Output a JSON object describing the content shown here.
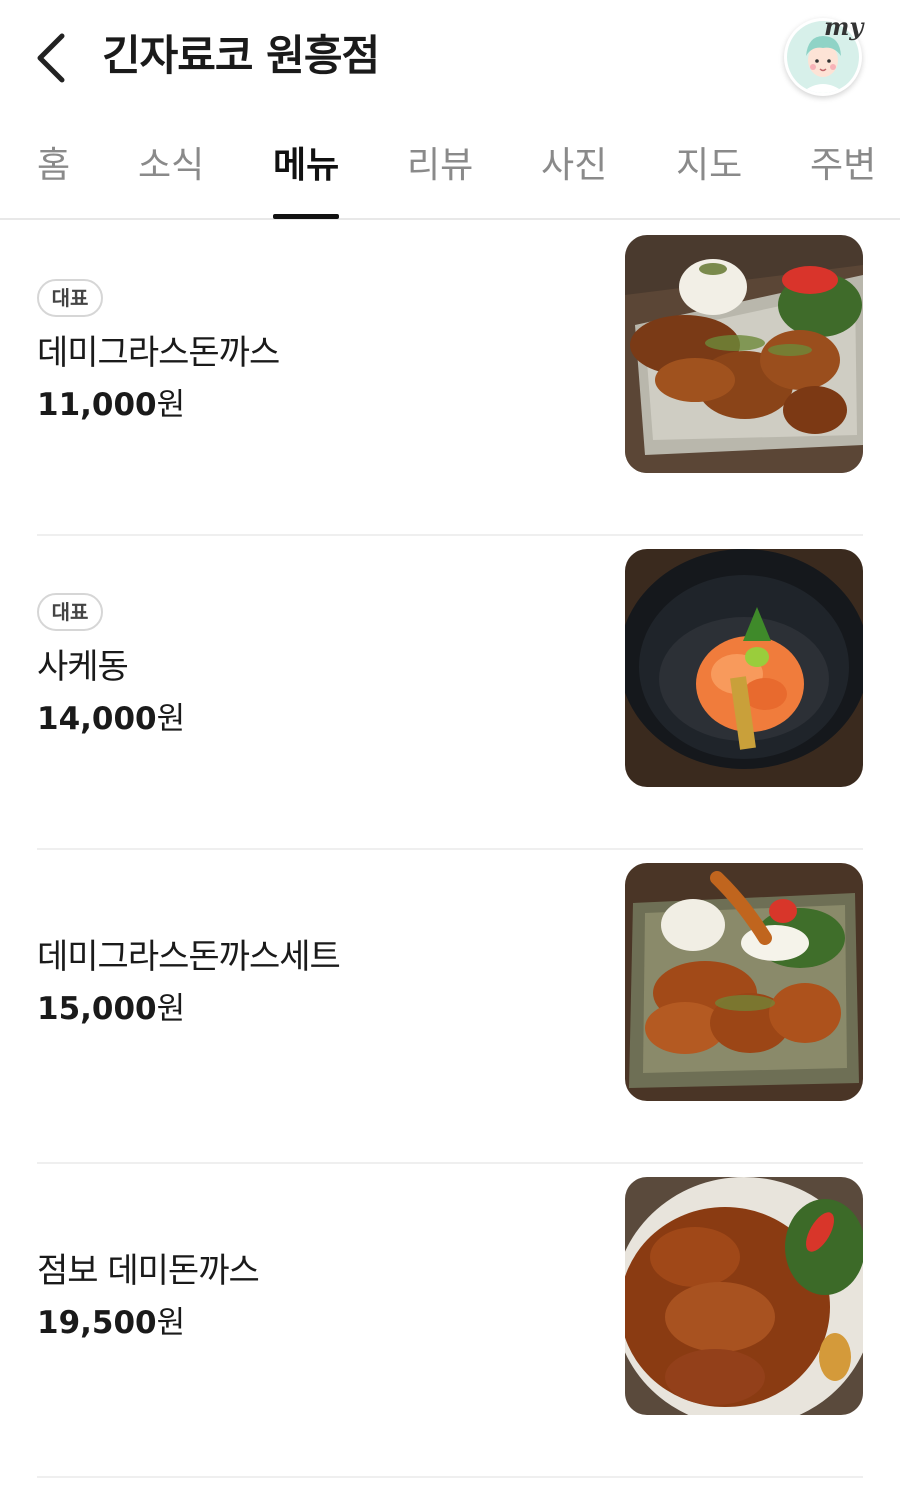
{
  "header": {
    "title": "긴자료코 원흥점",
    "back_icon": "chevron-left-icon",
    "avatar_label": "my"
  },
  "tabs": [
    {
      "label": "홈",
      "active": false
    },
    {
      "label": "소식",
      "active": false
    },
    {
      "label": "메뉴",
      "active": true
    },
    {
      "label": "리뷰",
      "active": false
    },
    {
      "label": "사진",
      "active": false
    },
    {
      "label": "지도",
      "active": false
    },
    {
      "label": "주변",
      "active": false
    }
  ],
  "menu": {
    "items": [
      {
        "badge": "대표",
        "name": "데미그라스돈까스",
        "price": "11,000",
        "unit": "원"
      },
      {
        "badge": "대표",
        "name": "사케동",
        "price": "14,000",
        "unit": "원"
      },
      {
        "badge": "",
        "name": "데미그라스돈까스세트",
        "price": "15,000",
        "unit": "원"
      },
      {
        "badge": "",
        "name": "점보 데미돈까스",
        "price": "19,500",
        "unit": "원"
      }
    ]
  },
  "colors": {
    "text_primary": "#111111",
    "tab_inactive": "#8a8a8a",
    "divider": "#efefef",
    "badge_border": "#d6d6d6"
  }
}
